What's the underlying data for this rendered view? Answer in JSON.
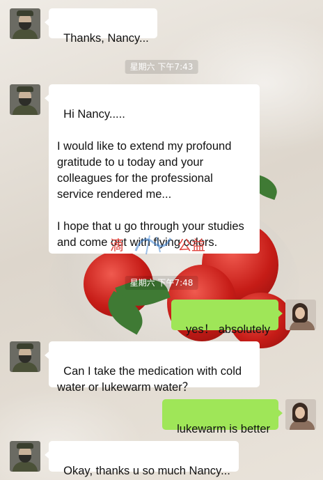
{
  "messages": [
    {
      "side": "left",
      "text": "Thanks, Nancy..."
    },
    {
      "timestamp": "星期六 下午7:43"
    },
    {
      "side": "left",
      "text": "Hi Nancy.....\n\nI would like to extend my profound gratitude to u today and your colleagues for the professional service rendered me...\n\nI hope that u go through your studies and come out with flying colors."
    },
    {
      "timestamp": "星期六 下午7:48"
    },
    {
      "side": "right",
      "text": "yes！ absolutely"
    },
    {
      "side": "left",
      "text": "Can I take the medication with cold water or lukewarm water？"
    },
    {
      "side": "right",
      "text": "lukewarm is better"
    },
    {
      "side": "left",
      "text": "Okay, thanks u so much Nancy..."
    }
  ],
  "watermark": {
    "text_1": "滴",
    "text_2": "公益"
  },
  "colors": {
    "incoming_bubble": "#ffffff",
    "outgoing_bubble": "#9fe658",
    "watermark": "#e0443e"
  }
}
